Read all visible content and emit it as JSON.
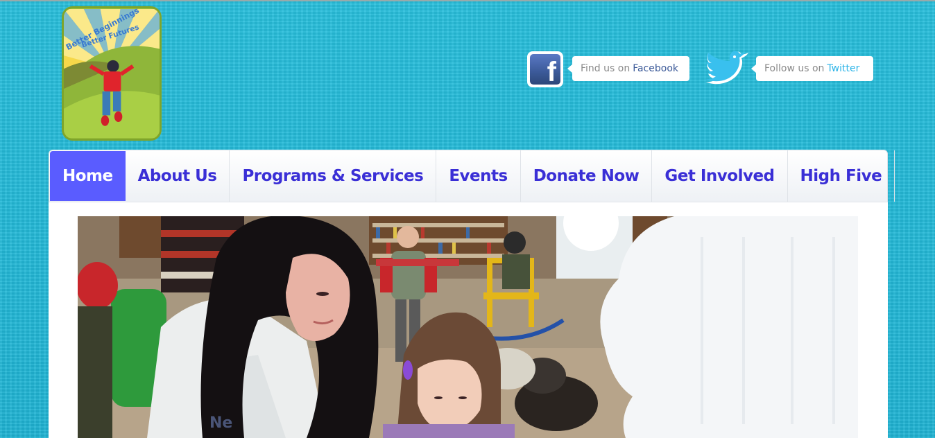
{
  "logo": {
    "line1": "Better Beginnings",
    "line2": "Better Futures"
  },
  "social": {
    "facebook": {
      "icon": "facebook-icon",
      "prefix": "Find us on",
      "brand": "Facebook",
      "glyph": "f",
      "color": "#3b5998"
    },
    "twitter": {
      "icon": "twitter-bird-icon",
      "prefix": "Follow us on",
      "brand": "Twitter",
      "color": "#2cb4e8"
    }
  },
  "nav": {
    "items": [
      {
        "label": "Home",
        "active": true
      },
      {
        "label": "About Us"
      },
      {
        "label": "Programs & Services"
      },
      {
        "label": "Events"
      },
      {
        "label": "Donate Now"
      },
      {
        "label": "Get Involved"
      },
      {
        "label": "High Five"
      }
    ],
    "active_color": "#5a5cff",
    "text_color": "#3a2fd6"
  },
  "hero": {
    "shirt_text": "Ne"
  },
  "colors": {
    "background": "#22b8d6"
  }
}
